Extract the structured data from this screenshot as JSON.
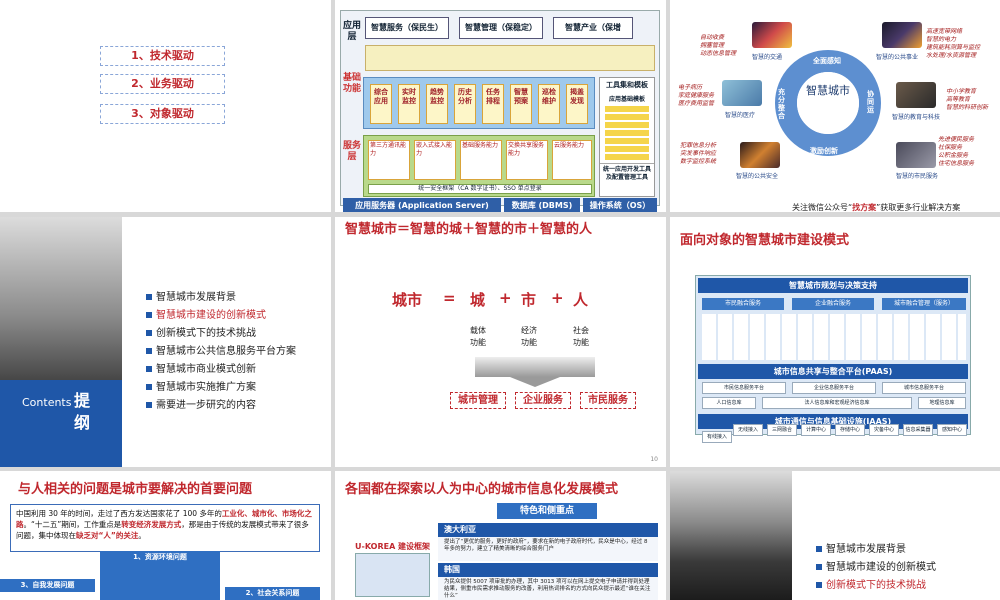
{
  "slide1": {
    "items": [
      "1、技术驱动",
      "2、业务驱动",
      "3、对象驱动"
    ]
  },
  "slide2": {
    "layers": {
      "app": "应用层",
      "base": "基础功能",
      "service": "服务层"
    },
    "apps": [
      "智慧服务（保民生）",
      "智慧管理（保稳定）",
      "智慧产业（保增"
    ],
    "functions": [
      "综合应用",
      "实时监控",
      "趋势监控",
      "历史分析",
      "任务排程",
      "智慧预案",
      "巡检维护",
      "揭盖发现"
    ],
    "services": [
      "第三方通讯能力",
      "嵌入式接入能力",
      "基础服务能力",
      "交换共享服务能力",
      "云服务能力"
    ],
    "service_bar": "统一安全框架（CA 数字证书）、SSO 单点登录",
    "tools_title": "工具集和模板",
    "tools_sub": "应用基础模板",
    "tools_footer": "统一应用开发工具及配置管理工具",
    "bottom": [
      "应用服务器 (Application Server)",
      "数据库 (DBMS)",
      "操作系统（OS）"
    ]
  },
  "slide3": {
    "center": "智慧城市",
    "ring_labels": [
      "全面感知",
      "协同运",
      "激励创新",
      "充分整合"
    ],
    "captions": [
      "智慧的交通",
      "智慧的公共事业",
      "智慧的医疗",
      "智慧的教育与科技",
      "智慧的公共安全",
      "智慧的市民服务"
    ],
    "bullets_tl": [
      "自动收费",
      "拥塞管理",
      "动态信息管理"
    ],
    "bullets_tr": [
      "高速宽带网络",
      "智慧的电力",
      "建筑能耗测算与监控",
      "水处理/水资源管理"
    ],
    "bullets_ml": [
      "电子病历",
      "家庭健康服务",
      "医疗费用监管"
    ],
    "bullets_mr": [
      "中小学教育",
      "高等教育",
      "智慧的科研创新"
    ],
    "bullets_bl": [
      "犯罪信息分析",
      "突发事件响应",
      "数字监控系统"
    ],
    "bullets_br": [
      "先进便民服务",
      "社保服务",
      "公积金服务",
      "住宅信息服务"
    ],
    "footer_prefix": "关注微信公众号“",
    "footer_highlight": "找方案",
    "footer_suffix": "”获取更多行业解决方案"
  },
  "outline": {
    "contents_en": "Contents",
    "contents_cn": "提纲",
    "items": [
      "智慧城市发展背景",
      "智慧城市建设的创新模式",
      "创新模式下的技术挑战",
      "智慧城市公共信息服务平台方案",
      "智慧城市商业模式创新",
      "智慧城市实施推广方案",
      "需要进一步研究的内容"
    ]
  },
  "slide5": {
    "title": "智慧城市＝智慧的城＋智慧的市＋智慧的人",
    "eq": [
      "城市",
      "=",
      "城",
      "+",
      "市",
      "+",
      "人"
    ],
    "captions": [
      "载体\n功能",
      "经济\n功能",
      "社会\n功能"
    ],
    "buttons": [
      "城市管理",
      "企业服务",
      "市民服务"
    ],
    "page": "10"
  },
  "slide6": {
    "title": "面向对象的智慧城市建设模式",
    "top_bar": "智慧城市规划与决策支持",
    "groups": [
      "市民融合服务",
      "企业融合服务",
      "城市融合管理（服务）"
    ],
    "paas_bar": "城市信息共享与整合平台(PAAS)",
    "paas_cells": [
      "市民信息服务平台",
      "企业信息服务平台",
      "城市信息服务平台",
      "人口信息库",
      "法人信息库和宏观经济信息库",
      "地理信息库"
    ],
    "iaas_bar": "城市通信与信息基础设施(IAAS)",
    "iaas_cells": [
      "有线接入",
      "无线接入",
      "三网融合",
      "计算中心",
      "存储中心",
      "灾备中心",
      "信息采集器",
      "感知中心"
    ]
  },
  "slide7": {
    "title": "与人相关的问题是城市要解决的首要问题",
    "text_a": "中国利用 30 年的时间，走过了西方发达国家花了 100 多年的",
    "text_red1": "工业化、城市化、市场化之路",
    "text_b": "。“十二五”期间，工作重点是",
    "text_red2": "转变经济发展方式",
    "text_c": "，那是由于传统的发展模式带来了很多问题，集中体现在",
    "text_red3": "缺乏对“人”的关注",
    "text_d": "。",
    "badges": [
      "1、资源环境问题",
      "3、自我发展问题",
      "2、社会关系问题"
    ]
  },
  "slide8": {
    "title": "各国都在探索以人为中心的城市信息化发展模式",
    "ribbon": "特色和侧重点",
    "ukorea": "U-KOREA 建设框架",
    "countries": [
      "澳大利亚",
      "韩国"
    ],
    "aus_text": "提出了“更优的服务，更好的政府”，要求在新的电子政府时代，民众是中心，经过 8 年多的努力，建立了精美清晰的综合服务门户",
    "kor_text": "为民众提供 5007 项审批的办理，其中 3013 项可以在网上提交电子申请并得到处理结果，侧重市民需求推动服务的改善，利用热词排名的方式向民众提示最近“谁在关注什么”"
  }
}
